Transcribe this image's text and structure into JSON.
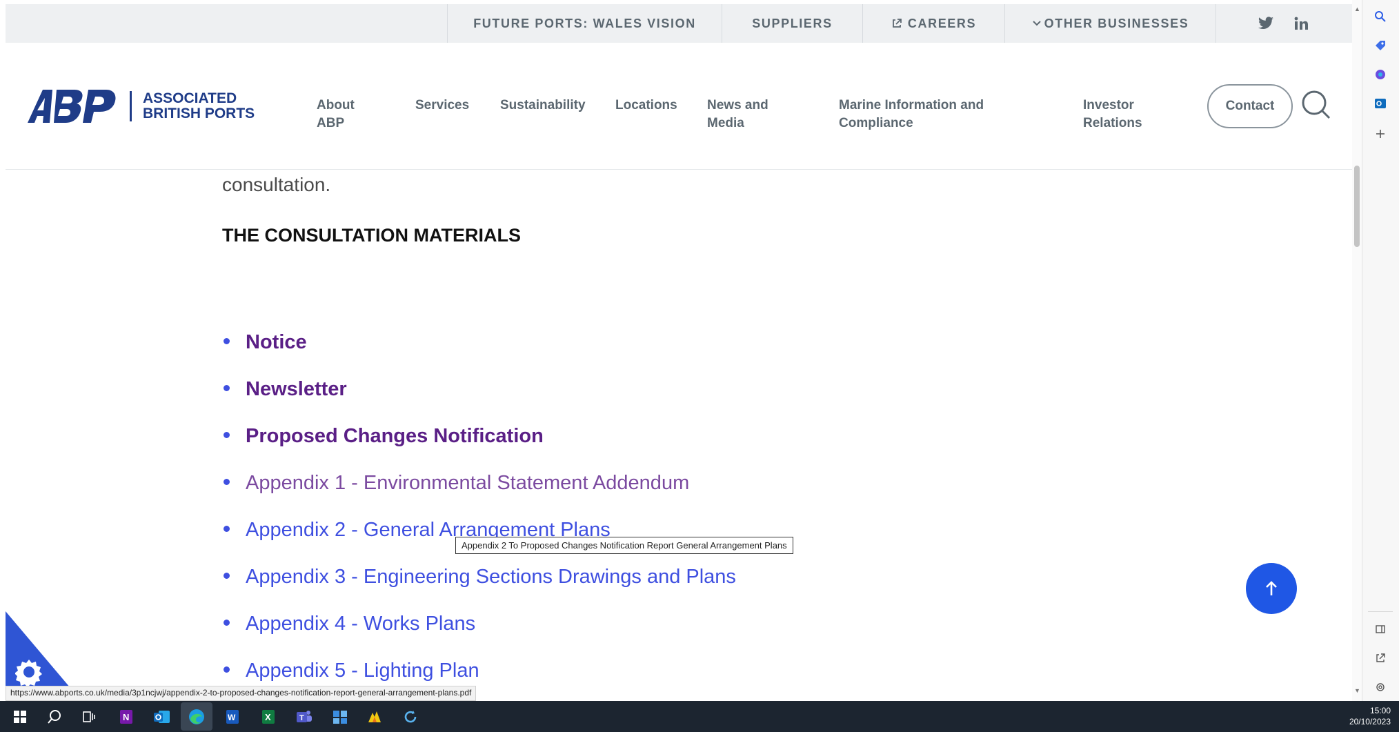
{
  "utility_bar": {
    "future_ports": "FUTURE PORTS: WALES VISION",
    "suppliers": "SUPPLIERS",
    "careers": "CAREERS",
    "other_businesses": "OTHER BUSINESSES",
    "social": [
      "twitter-icon",
      "linkedin-icon"
    ]
  },
  "logo": {
    "mark": "ABP",
    "line1": "ASSOCIATED",
    "line2": "BRITISH PORTS"
  },
  "nav": {
    "about_1": "About",
    "about_2": "ABP",
    "services": "Services",
    "sustainability": "Sustainability",
    "locations": "Locations",
    "news_1": "News and",
    "news_2": "Media",
    "marine_1": "Marine Information and",
    "marine_2": "Compliance",
    "investor_1": "Investor",
    "investor_2": "Relations",
    "contact": "Contact"
  },
  "content": {
    "lead_text": "consultation.",
    "section_title": "THE CONSULTATION MATERIALS",
    "documents": [
      {
        "label": "Notice",
        "style": "bold"
      },
      {
        "label": "Newsletter",
        "style": "bold"
      },
      {
        "label": "Proposed Changes Notification",
        "style": "bold"
      },
      {
        "label": "Appendix 1 - Environmental Statement Addendum",
        "style": "visited"
      },
      {
        "label": "Appendix 2 - General Arrangement Plans",
        "style": "link"
      },
      {
        "label": "Appendix 3 - Engineering Sections Drawings and Plans",
        "style": "link"
      },
      {
        "label": "Appendix 4 - Works Plans",
        "style": "link"
      },
      {
        "label": "Appendix 5 - Lighting Plan",
        "style": "link"
      }
    ],
    "tooltip": "Appendix 2 To Proposed Changes Notification Report General Arrangement Plans"
  },
  "status_url": "https://www.abports.co.uk/media/3p1ncjwj/appendix-2-to-proposed-changes-notification-report-general-arrangement-plans.pdf",
  "colors": {
    "brand_blue": "#1f3c88",
    "link_blue": "#3e4fe0",
    "link_purple": "#5a1f86",
    "button_blue": "#1f57e5"
  },
  "taskbar": {
    "icons": [
      "windows-start-icon",
      "search-icon",
      "task-view-icon",
      "onenote-icon",
      "outlook-icon",
      "edge-icon",
      "word-icon",
      "excel-icon",
      "teams-icon",
      "company-portal-icon",
      "powerbi-icon",
      "refresh-app-icon"
    ],
    "time": "15:00",
    "date": "20/10/2023"
  }
}
